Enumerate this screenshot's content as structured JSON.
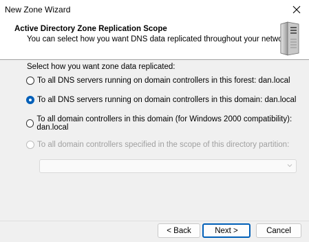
{
  "window": {
    "title": "New Zone Wizard",
    "close_glyph": "✕"
  },
  "header": {
    "title": "Active Directory Zone Replication Scope",
    "subtitle": "You can select how you want DNS data replicated throughout your network.",
    "icon": "server-tower-icon"
  },
  "main": {
    "prompt": "Select how you want zone data replicated:",
    "options": [
      {
        "label": "To all DNS servers running on domain controllers in this forest: dan.local",
        "checked": false,
        "enabled": true
      },
      {
        "label": "To all DNS servers running on domain controllers in this domain: dan.local",
        "checked": true,
        "enabled": true
      },
      {
        "label": "To all domain controllers in this domain (for Windows 2000 compatibility): dan.local",
        "checked": false,
        "enabled": true
      },
      {
        "label": "To all domain controllers specified in the scope of this directory partition:",
        "checked": false,
        "enabled": false
      }
    ],
    "partition_select": {
      "value": "",
      "enabled": false
    }
  },
  "footer": {
    "back_label": "< Back",
    "next_label": "Next >",
    "cancel_label": "Cancel"
  },
  "colors": {
    "accent": "#005fb8",
    "background": "#f0f0f0",
    "header_bg": "#ffffff",
    "disabled_text": "#a0a0a0"
  }
}
